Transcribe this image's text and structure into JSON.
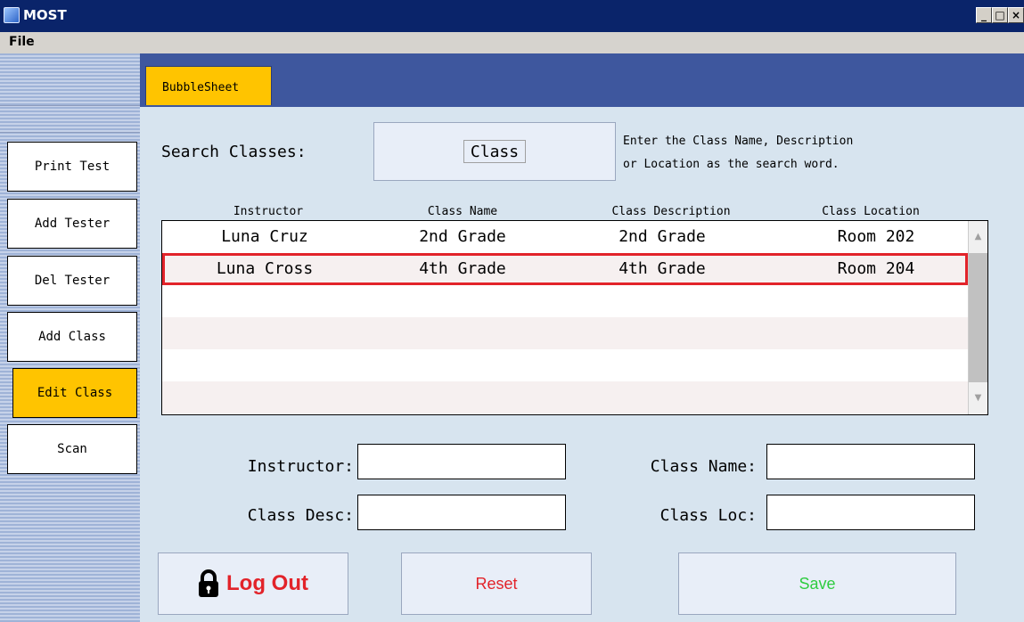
{
  "window": {
    "title": "MOST",
    "minimize": "_",
    "maximize": "□",
    "close": "×"
  },
  "menu": {
    "file": "File"
  },
  "sidebar": {
    "items": [
      {
        "label": "Print Test",
        "active": false
      },
      {
        "label": "Add Tester",
        "active": false
      },
      {
        "label": "Del Tester",
        "active": false
      },
      {
        "label": "Add Class",
        "active": false
      },
      {
        "label": "Edit Class",
        "active": true
      },
      {
        "label": "Scan",
        "active": false
      }
    ]
  },
  "tabs": [
    {
      "label": "BubbleSheet",
      "active": true
    }
  ],
  "search": {
    "label": "Search Classes:",
    "value": "Class",
    "hint_line1": "Enter the Class Name, Description",
    "hint_line2": "or Location as the search word."
  },
  "table": {
    "columns": [
      "Instructor",
      "Class Name",
      "Class Description",
      "Class Location"
    ],
    "rows": [
      [
        "Luna Cruz",
        "2nd Grade",
        "2nd Grade",
        "Room 202"
      ],
      [
        "Luna Cross",
        "4th Grade",
        "4th Grade",
        "Room 204"
      ]
    ],
    "selected_row": 1
  },
  "form": {
    "instructor_label": "Instructor:",
    "class_name_label": "Class Name:",
    "class_desc_label": "Class Desc:",
    "class_loc_label": "Class Loc:",
    "instructor_value": "",
    "class_name_value": "",
    "class_desc_value": "",
    "class_loc_value": ""
  },
  "buttons": {
    "logout": "Log Out",
    "reset": "Reset",
    "save": "Save"
  },
  "colors": {
    "accent": "#ffc400",
    "header": "#3e579e",
    "panel": "#d7e4ef",
    "selection": "#e2232a",
    "logout_text": "#e2232a",
    "reset_text": "#e2232a",
    "save_text": "#2ecc40"
  },
  "icons": {
    "logout": "lock-icon"
  }
}
